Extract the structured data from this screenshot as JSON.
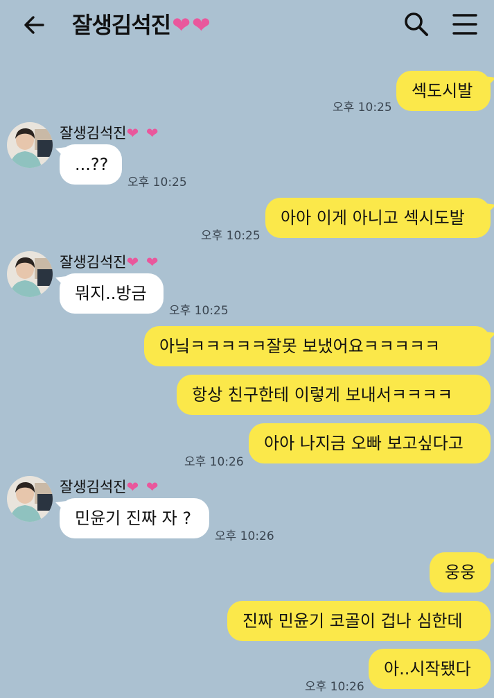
{
  "header": {
    "title": "잘생김석진",
    "title_hearts": "❤❤"
  },
  "messages": [
    {
      "side": "me",
      "text": "섹도시발",
      "time": "오후 10:25"
    },
    {
      "side": "other",
      "sender": "잘생김석진",
      "sender_hearts": "❤ ❤",
      "text": "...??",
      "time": "오후 10:25"
    },
    {
      "side": "me",
      "text": "아아 이게 아니고 섹시도발",
      "time": "오후 10:25"
    },
    {
      "side": "other",
      "sender": "잘생김석진",
      "sender_hearts": "❤ ❤",
      "text": "뭐지..방금",
      "time": "오후 10:25"
    },
    {
      "side": "me",
      "text": "아닠ㅋㅋㅋㅋㅋ잘못 보냈어요ㅋㅋㅋㅋㅋ",
      "time": ""
    },
    {
      "side": "me",
      "text": "항상 친구한테 이렇게 보내서ㅋㅋㅋㅋ",
      "time": ""
    },
    {
      "side": "me",
      "text": "아아 나지금 오빠 보고싶다고",
      "time": "오후 10:26"
    },
    {
      "side": "other",
      "sender": "잘생김석진",
      "sender_hearts": "❤ ❤",
      "text": "민윤기 진짜 자 ?",
      "time": "오후 10:26"
    },
    {
      "side": "me",
      "text": "웅웅",
      "time": ""
    },
    {
      "side": "me",
      "text": "진짜 민윤기 코골이 겁나 심한데",
      "time": ""
    },
    {
      "side": "me",
      "text": "아..시작됐다",
      "time": "오후 10:26"
    }
  ],
  "colors": {
    "background": "#abc1d1",
    "my_bubble": "#fbe84a",
    "other_bubble": "#ffffff",
    "heart": "#e9579c"
  },
  "icons": [
    "back-arrow-icon",
    "search-icon",
    "menu-icon",
    "avatar"
  ]
}
